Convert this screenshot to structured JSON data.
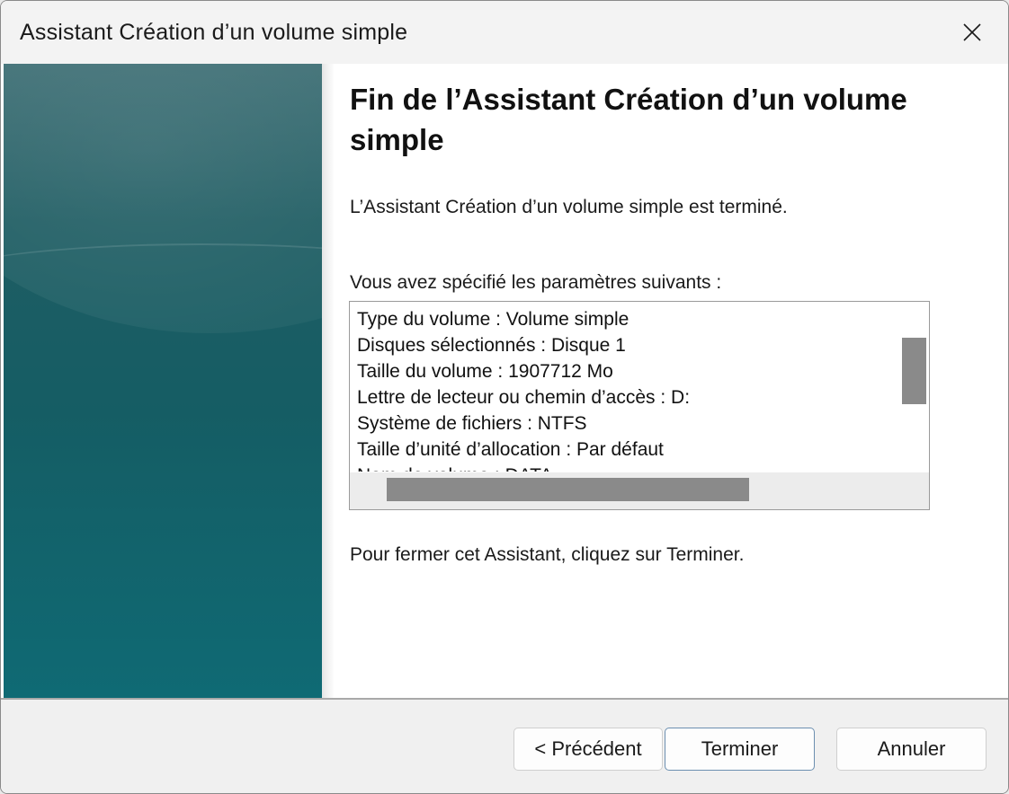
{
  "window": {
    "title": "Assistant Création d’un volume simple"
  },
  "heading": "Fin de l’Assistant Création d’un volume simple",
  "completed_text": "L’Assistant Création d’un volume simple est terminé.",
  "settings_label": "Vous avez spécifié les paramètres suivants :",
  "settings": [
    "Type du volume : Volume simple",
    "Disques sélectionnés : Disque 1",
    "Taille du volume : 1907712 Mo",
    "Lettre de lecteur ou chemin d’accès : D:",
    "Système de fichiers : NTFS",
    "Taille d’unité d’allocation : Par défaut",
    "Nom de volume : DATA"
  ],
  "close_instruction": "Pour fermer cet Assistant, cliquez sur Terminer.",
  "buttons": {
    "back": "< Précédent",
    "finish": "Terminer",
    "cancel": "Annuler"
  },
  "icons": {
    "close": "close-icon"
  },
  "colors": {
    "banner": "#155d64",
    "scroll_thumb": "#8a8a8a",
    "default_button_border": "#6c8fb0"
  }
}
